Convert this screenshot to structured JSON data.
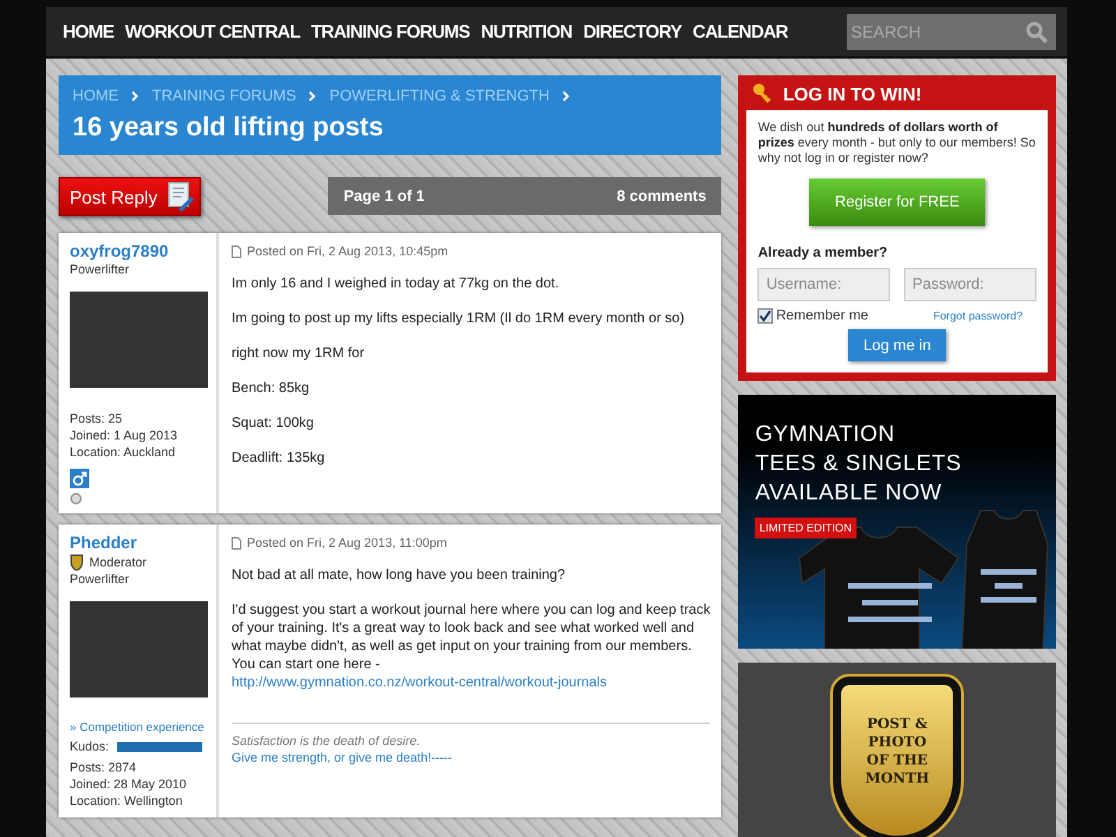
{
  "nav": {
    "items": [
      {
        "label": "HOME"
      },
      {
        "label": "WORKOUT CENTRAL"
      },
      {
        "label": "TRAINING FORUMS"
      },
      {
        "label": "NUTRITION"
      },
      {
        "label": "DIRECTORY"
      },
      {
        "label": "CALENDAR"
      }
    ],
    "search": {
      "placeholder": "SEARCH"
    }
  },
  "breadcrumb": [
    "HOME",
    "TRAINING FORUMS",
    "POWERLIFTING & STRENGTH"
  ],
  "title": "16 years old lifting posts",
  "post_reply": "Post Reply",
  "pagination": {
    "page": "Page 1 of 1",
    "count": "8 comments"
  },
  "posts": [
    {
      "username": "oxyfrog7890",
      "title": "Powerlifter",
      "stats": [
        "Posts: 25",
        "Joined: 1 Aug 2013",
        "Location: Auckland"
      ],
      "profile_icons": [
        {
          "kind": "male"
        },
        {
          "kind": "status"
        }
      ],
      "date": "Posted on Fri, 2 Aug 2013, 10:45pm",
      "body": [
        {
          "text": "Im only 16 and I weighed in today at 77kg on the dot."
        },
        {
          "text": "Im going to post up my lifts especially 1RM (Il do 1RM every month or so)"
        },
        {
          "text": "right now my 1RM for"
        },
        {
          "text": "Bench: 85kg"
        },
        {
          "text": "Squat: 100kg"
        },
        {
          "text": "Deadlift: 135kg"
        }
      ]
    },
    {
      "username": "Phedder",
      "role": "Moderator",
      "title": "Powerlifter",
      "link": "» Competition experience",
      "kudos": {
        "label": "Kudos:",
        "level": 1
      },
      "stats": [
        "Posts: 2874",
        "Joined: 28 May 2010",
        "Location: Wellington"
      ],
      "date": "Posted on Fri, 2 Aug 2013, 11:00pm",
      "body": [
        {
          "text": "Not bad at all mate, how long have you been training?"
        },
        {
          "text": "I'd suggest you start a workout journal here where you can log and keep track of your training. It's a great way to look back and see what worked well and what maybe didn't, as well as get input on your training from our members. You can start one here - ",
          "link": "http://www.gymnation.co.nz/workout-central/workout-journals"
        }
      ],
      "signature": [
        {
          "kind": "quote",
          "text": "Satisfaction is the death of desire."
        },
        {
          "kind": "link",
          "text": "Give me strength, or give me death!-----"
        }
      ]
    }
  ],
  "login": {
    "title": "LOG IN TO WIN!",
    "intro": "We dish out **hundreds of dollars worth of prizes** every month - but only to our members! So why not log in or register now?",
    "register": "Register for FREE",
    "member": "Already a member?",
    "username": {
      "placeholder": "Username:"
    },
    "password": {
      "placeholder": "Password:"
    },
    "remember": {
      "label": "Remember me",
      "checked": true
    },
    "forgot": "Forgot password?",
    "submit": "Log me in"
  },
  "banner": {
    "lines": [
      "GYMNATION",
      "TEES & SINGLETS",
      "AVAILABLE NOW"
    ],
    "badge": "LIMITED EDITION"
  },
  "award": {
    "lines": [
      "POST &",
      "PHOTO",
      "OF THE",
      "MONTH"
    ]
  }
}
